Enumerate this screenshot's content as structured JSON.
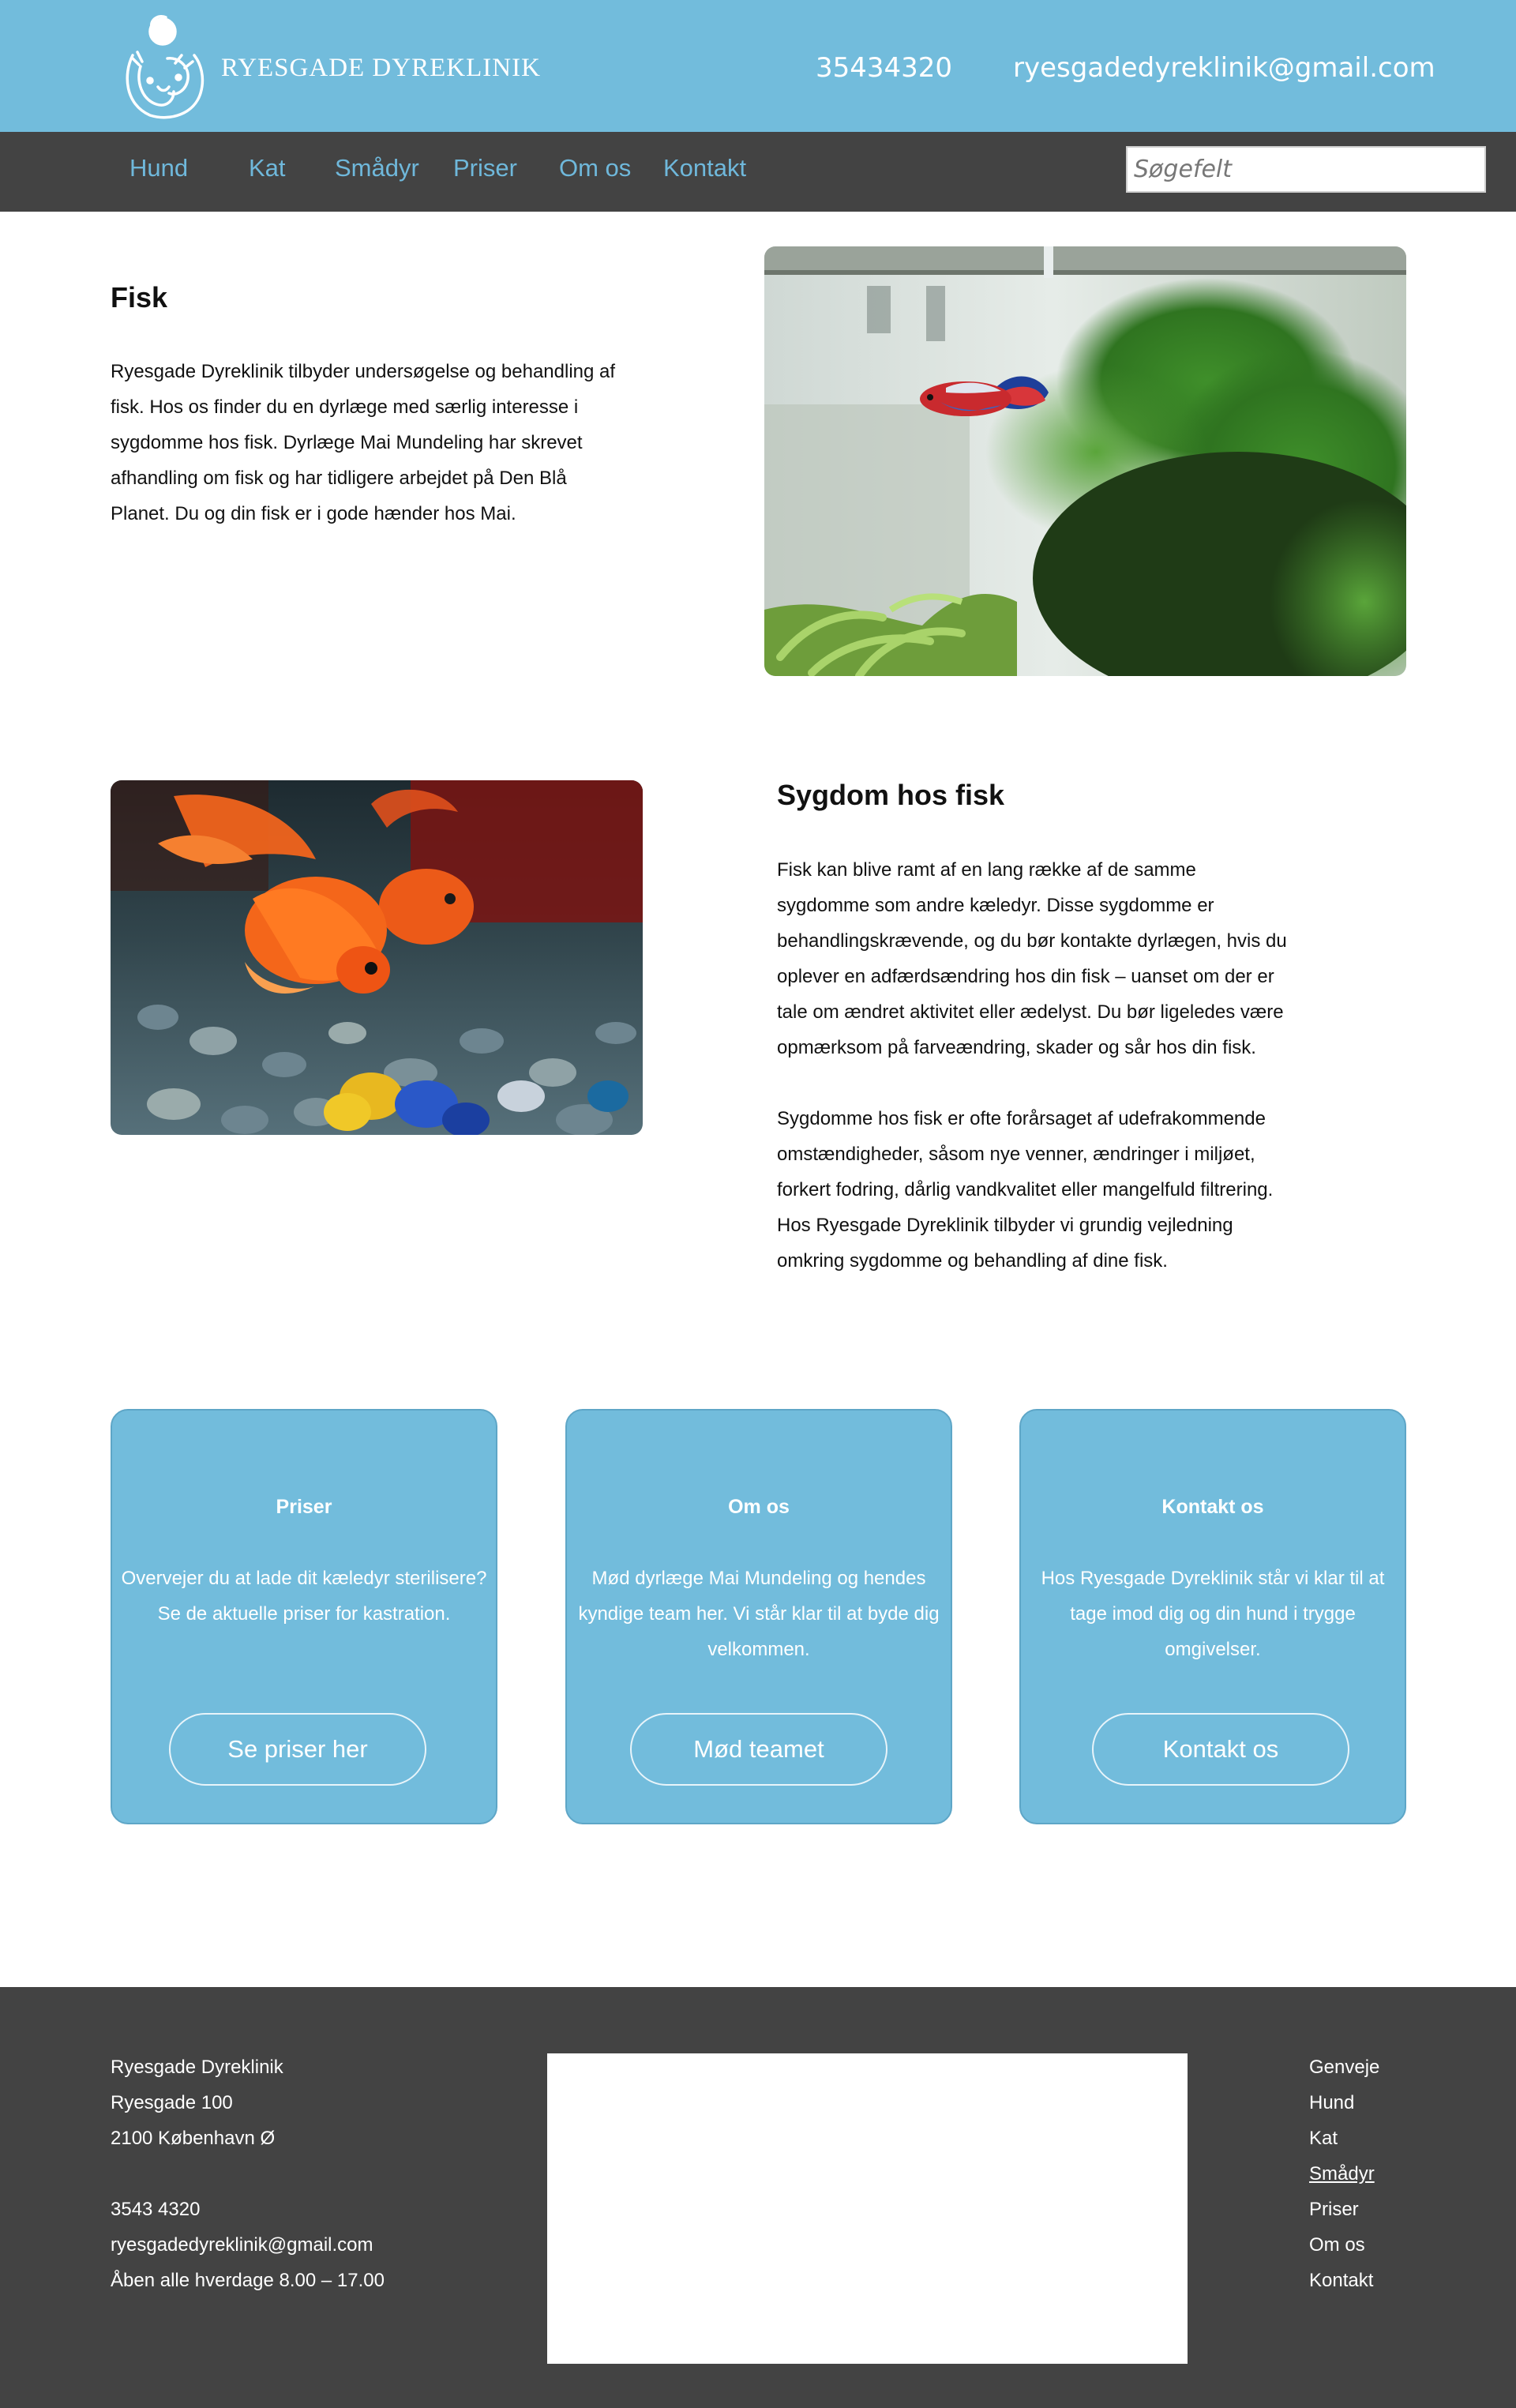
{
  "header": {
    "logo_text": "RYESGADE DYREKLINIK",
    "phone": "35434320",
    "email": "ryesgadedyreklinik@gmail.com",
    "colors": {
      "bar": "#72bcdc",
      "nav": "#434343",
      "nav_link": "#6fb8db"
    }
  },
  "nav": {
    "items": [
      {
        "label": "Hund"
      },
      {
        "label": "Kat"
      },
      {
        "label": "Smådyr"
      },
      {
        "label": "Priser"
      },
      {
        "label": "Om os"
      },
      {
        "label": "Kontakt"
      }
    ],
    "search_placeholder": "Søgefelt"
  },
  "section1": {
    "heading": "Fisk",
    "lines": [
      "Ryesgade Dyreklinik tilbyder undersøgelse og behandling af",
      "fisk. Hos os finder du en dyrlæge med særlig interesse i",
      "sygdomme hos fisk. Dyrlæge Mai Mundeling har skrevet",
      "afhandling om fisk og har tidligere arbejdet på Den Blå",
      "Planet. Du og din fisk er i gode hænder hos Mai."
    ]
  },
  "section2": {
    "heading": "Sygdom hos fisk",
    "lines1": [
      "Fisk kan blive ramt af en lang række af de samme",
      "sygdomme som andre kæledyr. Disse sygdomme er",
      "behandlingskrævende, og du bør kontakte dyrlægen, hvis du",
      "oplever en adfærdsændring hos din fisk – uanset om der er",
      "tale om ændret aktivitet eller ædelyst. Du bør ligeledes være",
      "opmærksom på farveændring, skader og sår hos din fisk."
    ],
    "lines2": [
      "Sygdomme hos fisk er ofte forårsaget af udefrakommende",
      "omstændigheder, såsom nye venner, ændringer i miljøet,",
      "forkert fodring, dårlig vandkvalitet eller mangelfuld filtrering.",
      "Hos Ryesgade Dyreklinik tilbyder vi grundig vejledning",
      "omkring sygdomme og behandling af dine fisk."
    ]
  },
  "cards": [
    {
      "title": "Priser",
      "lines": [
        "Overvejer du at lade dit kæledyr sterilisere?",
        "Se de aktuelle priser for kastration."
      ],
      "button": "Se priser her"
    },
    {
      "title": "Om os",
      "lines": [
        "Mød dyrlæge Mai Mundeling og hendes",
        "kyndige team her. Vi står klar til at byde dig",
        "velkommen."
      ],
      "button": "Mød teamet"
    },
    {
      "title": "Kontakt os",
      "lines": [
        "Hos Ryesgade Dyreklinik står vi klar til at",
        "tage imod dig og din hund i trygge",
        "omgivelser."
      ],
      "button": "Kontakt os"
    }
  ],
  "footer": {
    "address": [
      "Ryesgade Dyreklinik",
      "Ryesgade 100",
      "2100 København Ø"
    ],
    "contact": [
      "3543 4320",
      "ryesgadedyreklinik@gmail.com",
      "Åben alle hverdage 8.00 – 17.00"
    ],
    "links_title": "Genveje",
    "links": [
      "Hund",
      "Kat",
      "Smådyr",
      "Priser",
      "Om os",
      "Kontakt"
    ]
  }
}
